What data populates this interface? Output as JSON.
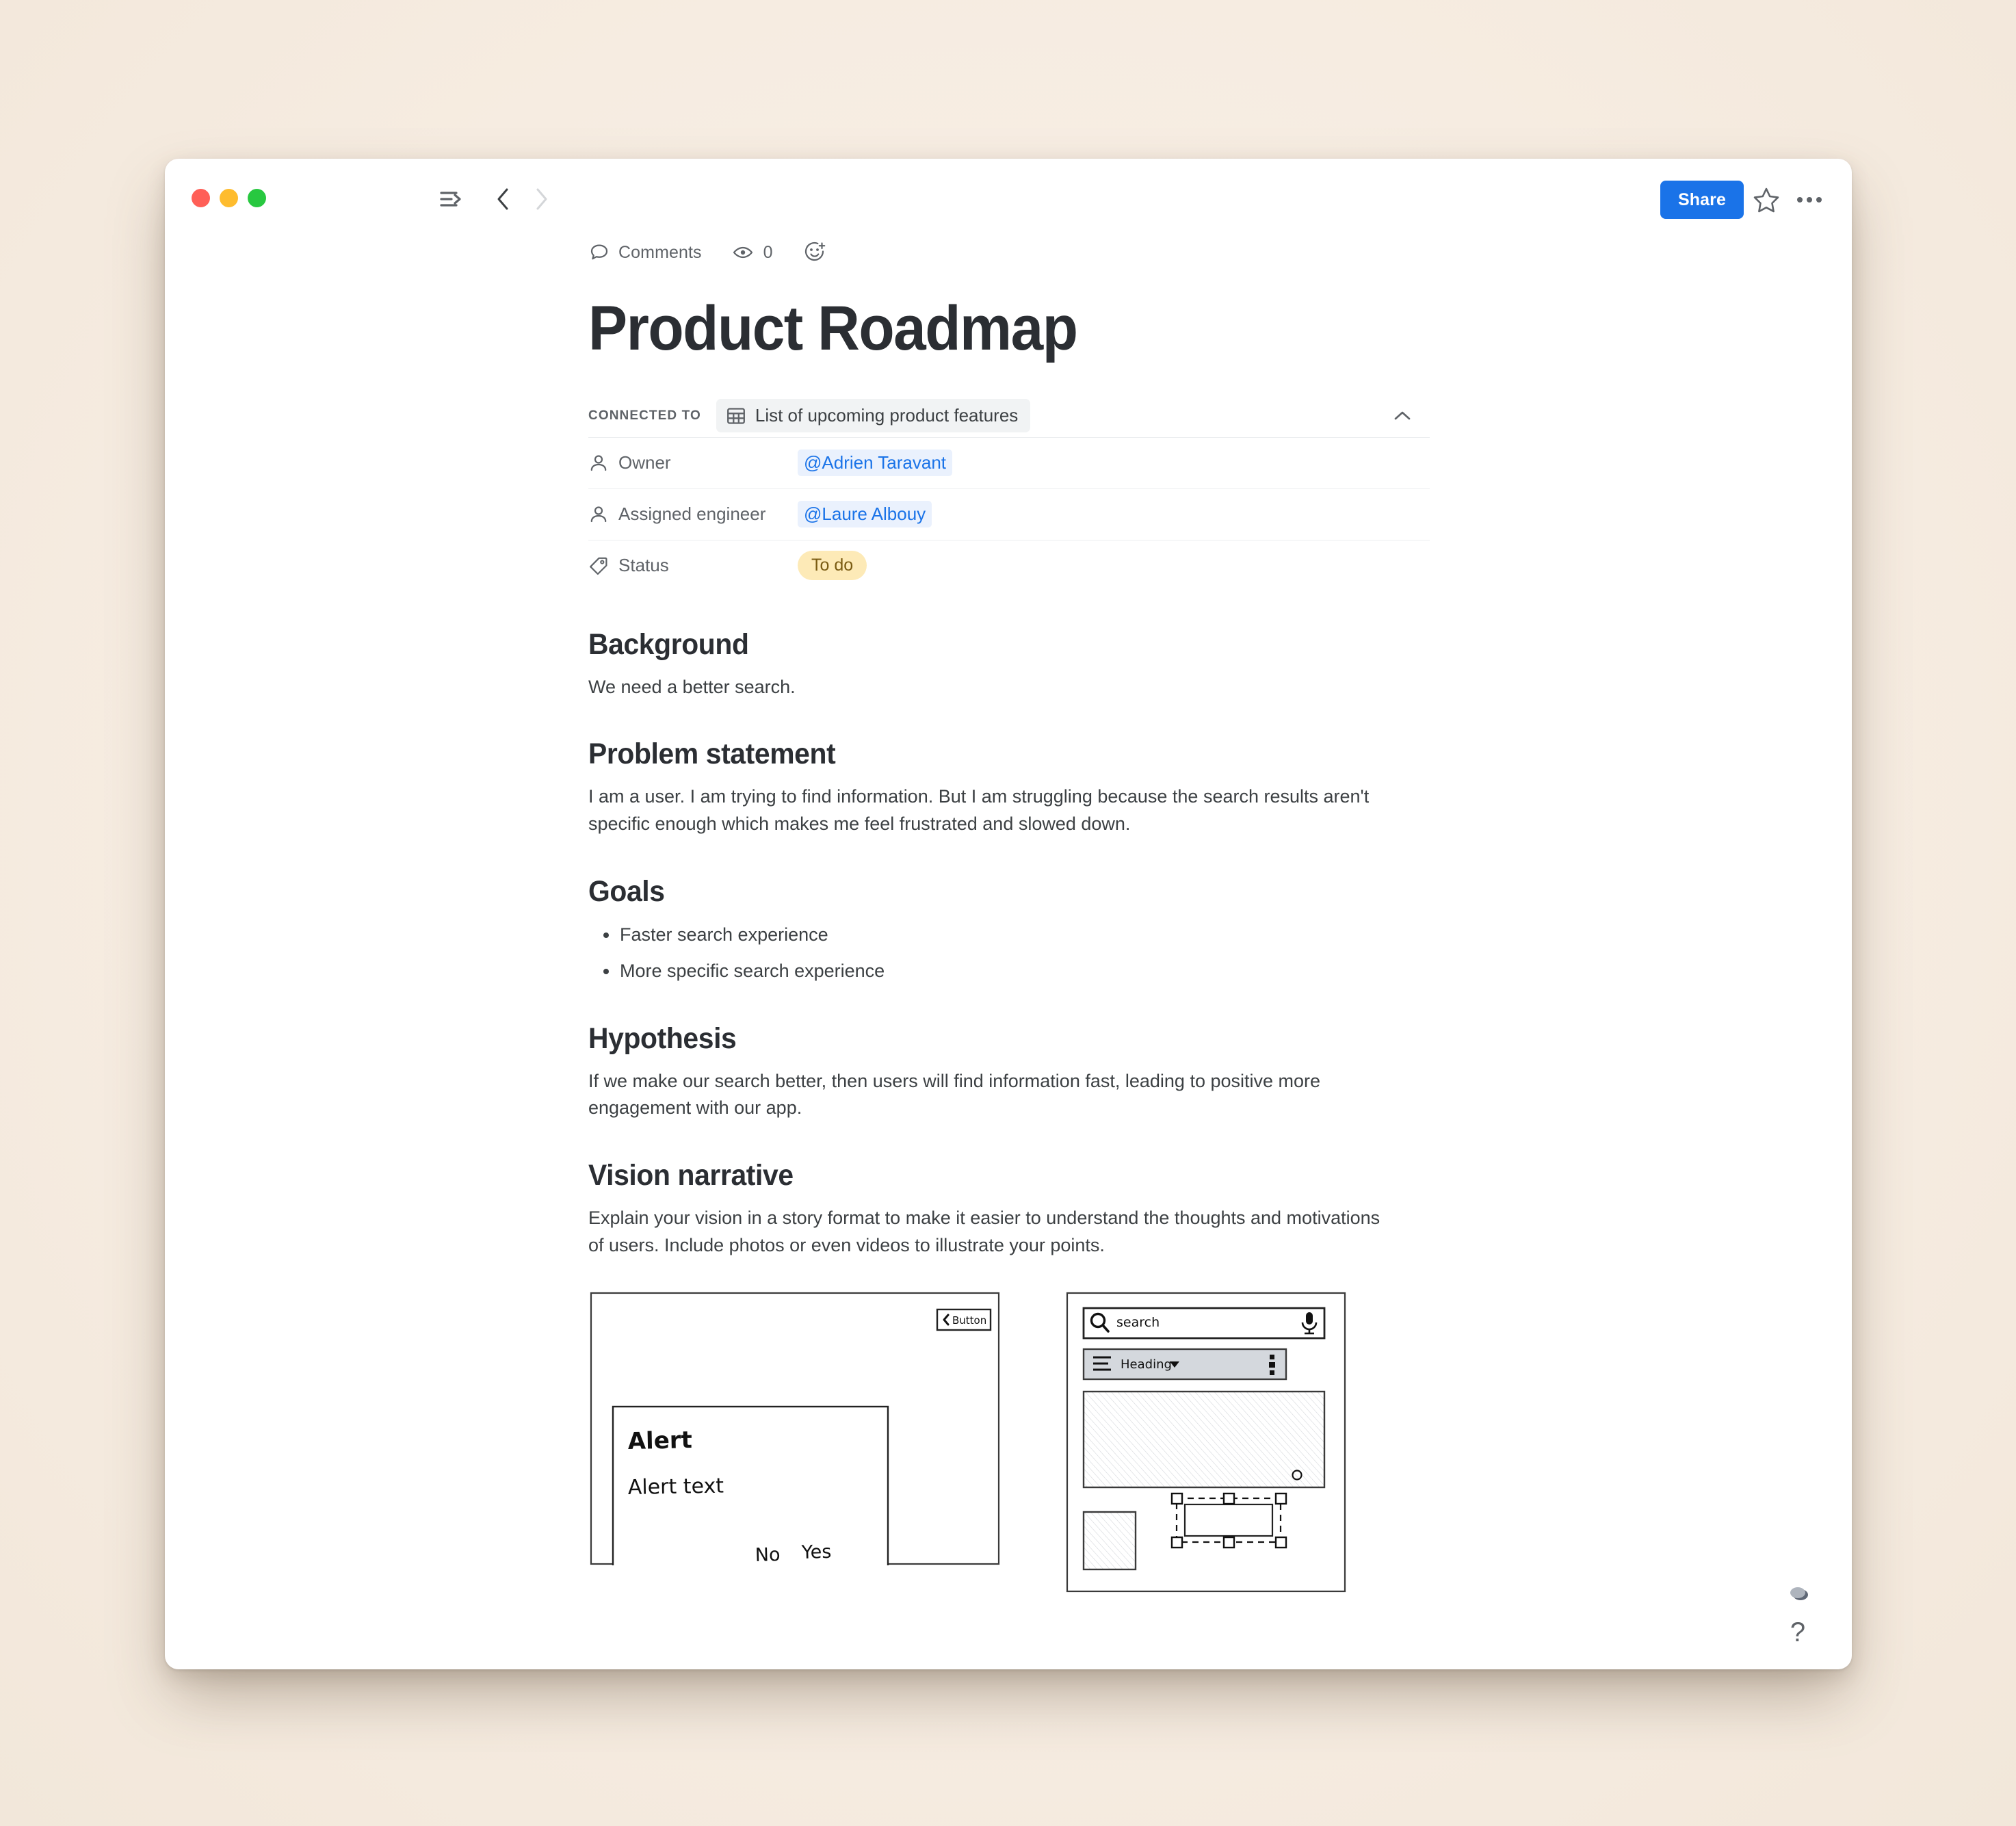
{
  "window": {
    "titlebar": {
      "traffic_lights": [
        {
          "name": "close",
          "color": "#ff5f57"
        },
        {
          "name": "minimize",
          "color": "#febc2e"
        },
        {
          "name": "maximize",
          "color": "#28c840"
        }
      ],
      "sidebar_toggle_icon": "sidebar-expand-icon",
      "back_icon": "chevron-left-icon",
      "forward_icon": "chevron-right-icon",
      "share_label": "Share",
      "star_icon": "star-outline-icon",
      "more_icon": "ellipsis-horizontal-icon",
      "accent_color": "#1a73e8"
    }
  },
  "metabar": {
    "comments_icon": "comment-bubble-icon",
    "comments_label": "Comments",
    "views_icon": "eye-icon",
    "views_count": "0",
    "reaction_icon": "add-reaction-icon"
  },
  "document": {
    "title": "Product Roadmap",
    "connected": {
      "label": "CONNECTED TO",
      "source_icon": "table-grid-icon",
      "source_name": "List of upcoming product features",
      "collapse_icon": "chevron-up-icon"
    },
    "properties": [
      {
        "icon": "person-icon",
        "label": "Owner",
        "value": "@Adrien Taravant",
        "type": "mention"
      },
      {
        "icon": "person-icon",
        "label": "Assigned engineer",
        "value": "@Laure Albouy",
        "type": "mention"
      },
      {
        "icon": "tag-icon",
        "label": "Status",
        "value": "To do",
        "type": "pill",
        "pill_bg": "#fdeab7",
        "pill_fg": "#7a5b12"
      }
    ],
    "sections": [
      {
        "heading": "Background",
        "paragraphs": [
          "We need a better search."
        ]
      },
      {
        "heading": "Problem statement",
        "paragraphs": [
          "I am a user. I am trying to find information. But I am struggling because the search results aren't specific enough which makes me feel frustrated and slowed down."
        ]
      },
      {
        "heading": "Goals",
        "bullets": [
          "Faster search experience",
          "More specific search experience"
        ]
      },
      {
        "heading": "Hypothesis",
        "paragraphs": [
          "If we make our search better, then users will find information fast, leading to positive more engagement with our app."
        ]
      },
      {
        "heading": "Vision narrative",
        "paragraphs": [
          "Explain your vision in a story format to make it easier to understand the thoughts and motivations of users. Include photos or even videos to illustrate your points."
        ]
      }
    ],
    "wireframes": [
      {
        "name": "alert-dialog-wireframe",
        "button_label": "Button",
        "alert_title": "Alert",
        "alert_text": "Alert text",
        "action_no": "No",
        "action_yes": "Yes"
      },
      {
        "name": "search-screen-wireframe",
        "search_placeholder": "search",
        "search_icon": "magnifier-icon",
        "mic_icon": "microphone-icon",
        "menu_icon": "hamburger-icon",
        "heading_label": "Heading",
        "heading_caret": "caret-down-icon",
        "overflow_icon": "vertical-dots-icon"
      }
    ]
  },
  "footer": {
    "orb_icon": "status-orb-icon",
    "help_label": "?"
  }
}
